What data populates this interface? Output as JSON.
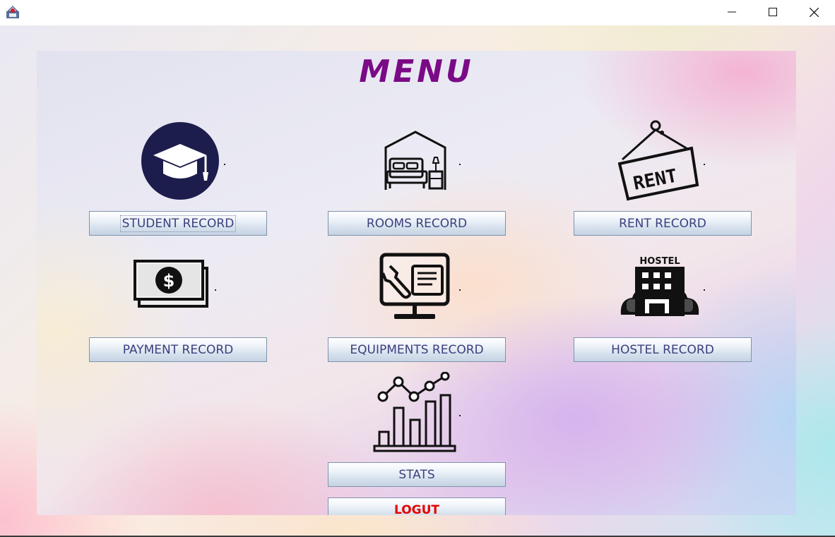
{
  "window": {
    "app_icon": "java-app-icon",
    "controls": [
      "minimize-icon",
      "maximize-icon",
      "close-icon"
    ]
  },
  "menu": {
    "title": "MENU",
    "buttons": {
      "student": "STUDENT RECORD",
      "rooms": "ROOMS RECORD",
      "rent": "RENT RECORD",
      "payment": "PAYMENT RECORD",
      "equipments": "EQUIPMENTS RECORD",
      "hostel": "HOSTEL RECORD",
      "stats": "STATS",
      "logout": "LOGUT"
    },
    "icon_text": {
      "rent": "RENT",
      "hostel": "HOSTEL"
    }
  },
  "colors": {
    "title": "#7a0a86",
    "button_text": "#3b3f7e",
    "logout_text": "#e40000"
  }
}
